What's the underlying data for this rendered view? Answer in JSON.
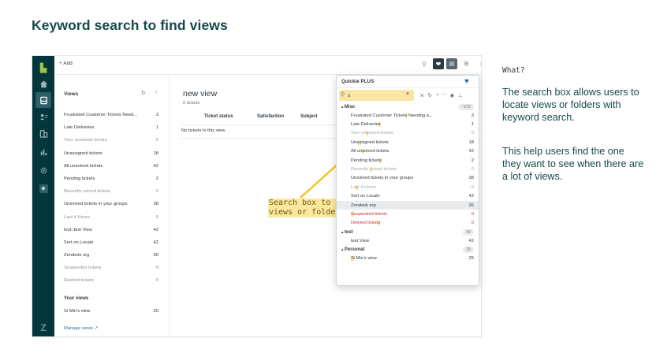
{
  "page": {
    "heading": "Keyword search to find views"
  },
  "app": {
    "add_label": "+ Add",
    "views_panel": {
      "title": "Views",
      "items": [
        {
          "label": "Frustrated Customer Tickets Need...",
          "count": "3",
          "muted": false
        },
        {
          "label": "Late Deliveries",
          "count": "1",
          "muted": false
        },
        {
          "label": "Your unsolved tickets",
          "count": "0",
          "muted": true
        },
        {
          "label": "Unassigned tickets",
          "count": "18",
          "muted": false
        },
        {
          "label": "All unsolved tickets",
          "count": "42",
          "muted": false
        },
        {
          "label": "Pending tickets",
          "count": "2",
          "muted": false
        },
        {
          "label": "Recently solved tickets",
          "count": "0",
          "muted": true
        },
        {
          "label": "Unsolved tickets in your groups",
          "count": "38",
          "muted": false
        },
        {
          "label": "Last 4 Hours",
          "count": "0",
          "muted": true
        },
        {
          "label": "test::test View",
          "count": "42",
          "muted": false
        },
        {
          "label": "Sort on Locale",
          "count": "42",
          "muted": false
        },
        {
          "label": "Zendesk org",
          "count": "26",
          "muted": false
        },
        {
          "label": "Suspended tickets",
          "count": "0",
          "muted": true
        },
        {
          "label": "Deleted tickets",
          "count": "0",
          "muted": true
        }
      ],
      "your_views_title": "Your views",
      "your_views": [
        {
          "label": "Si Min's view",
          "count": "25"
        }
      ],
      "manage_views": "Manage views ↗"
    },
    "main": {
      "title": "new view",
      "subtitle": "0 tickets",
      "columns": [
        "Ticket status",
        "Satisfaction",
        "Subject"
      ],
      "empty_text": "No tickets in this view"
    },
    "annotation": {
      "line1": "Search box to find",
      "line2": "views or folders"
    },
    "quickie": {
      "title": "Quickie PLUS",
      "search_value": "s",
      "clear_glyph": "×",
      "groups": [
        {
          "name": "Misc",
          "badge": "~172",
          "rows": [
            {
              "pre": "Frustrated Customer Ticket",
              "hl": "s",
              "post": " Needing a...",
              "count": "3",
              "style": "normal",
              "selected": false
            },
            {
              "pre": "Late Deliverie",
              "hl": "s",
              "post": "",
              "count": "1",
              "style": "normal",
              "selected": false
            },
            {
              "pre": "Your un",
              "hl": "s",
              "post": "olved tickets",
              "count": "0",
              "style": "muted",
              "selected": false
            },
            {
              "pre": "Una",
              "hl": "s",
              "post": "signed tickets",
              "count": "18",
              "style": "normal",
              "selected": false
            },
            {
              "pre": "All un",
              "hl": "s",
              "post": "olved tickets",
              "count": "42",
              "style": "normal",
              "selected": false
            },
            {
              "pre": "Pending ticket",
              "hl": "s",
              "post": "",
              "count": "2",
              "style": "normal",
              "selected": false
            },
            {
              "pre": "Recently ",
              "hl": "s",
              "post": "olved tickets",
              "count": "0",
              "style": "muted",
              "selected": false
            },
            {
              "pre": "Unsolved tickets ",
              "hl": "i",
              "post": "n your groups",
              "count": "38",
              "style": "normal",
              "selected": false
            },
            {
              "pre": "La",
              "hl": "s",
              "post": "t 4 Hours",
              "count": "~0",
              "style": "muted",
              "selected": false
            },
            {
              "pre": "Sort on Locale",
              "hl": "",
              "post": "",
              "count": "42",
              "style": "normal",
              "selected": false
            },
            {
              "pre": "Zendesk org",
              "hl": "",
              "post": "",
              "count": "26",
              "style": "normal",
              "selected": true
            },
            {
              "pre": "",
              "hl": "S",
              "post": "uspended tickets",
              "count": "0",
              "style": "red",
              "selected": false
            },
            {
              "pre": "Deleted ticket",
              "hl": "s",
              "post": "",
              "count": "0",
              "style": "red",
              "selected": false
            }
          ]
        },
        {
          "name": "test",
          "badge": "42",
          "rows": [
            {
              "pre": "test View",
              "hl": "",
              "post": "",
              "count": "42",
              "style": "normal",
              "selected": false
            }
          ]
        },
        {
          "name": "Personal",
          "badge": "25",
          "rows": [
            {
              "pre": "",
              "hl": "S",
              "post": "i Min's view",
              "count": "25",
              "style": "normal",
              "selected": false
            }
          ]
        }
      ]
    }
  },
  "side": {
    "heading": "What?",
    "para1": "The search box allows users to locate views or folders with keyword search.",
    "para2": "This help users find the one they want to see when there are a lot of views."
  },
  "colors": {
    "navbar": "#03363d",
    "highlight": "#fbe5a3",
    "annotation_bg": "#fbe8a0",
    "arrow": "#f5c518",
    "danger": "#cc3340",
    "link": "#1f73b7",
    "heading": "#17494d"
  }
}
